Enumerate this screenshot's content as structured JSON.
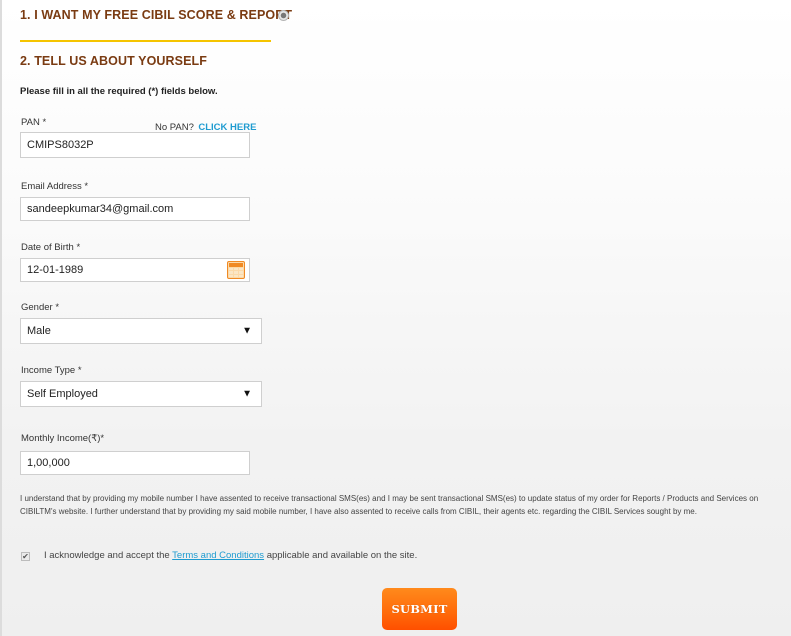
{
  "step1": {
    "title": "1. I WANT MY FREE CIBIL SCORE & REPORT"
  },
  "step2": {
    "title": "2. TELL US ABOUT YOURSELF"
  },
  "form": {
    "hint": "Please fill in all the required (*) fields below.",
    "pan": {
      "label": "PAN *",
      "no_pan_text": "No PAN?",
      "click_here": "CLICK HERE",
      "value": "CMIPS8032P"
    },
    "email": {
      "label": "Email Address *",
      "value": "sandeepkumar34@gmail.com"
    },
    "dob": {
      "label": "Date of Birth *",
      "value": "12-01-1989",
      "icon": "calendar-icon"
    },
    "gender": {
      "label": "Gender *",
      "selected": "Male",
      "arrow": "▼"
    },
    "income_type": {
      "label": "Income Type *",
      "selected": "Self Employed",
      "arrow": "▼"
    },
    "monthly_income": {
      "label": "Monthly Income(₹)*",
      "value": "1,00,000"
    },
    "disclaimer_line1": "I understand that by providing my mobile number I have assented to receive transactional SMS(es) and I may be sent transactional SMS(es) to update status of my order for Reports / Products and Services on",
    "disclaimer_line2": "CIBILTM's website. I further understand that by providing my said mobile number, I have also assented to receive calls from CIBIL, their agents etc. regarding the CIBIL Services sought by me.",
    "ack": {
      "checked": true,
      "check_mark": "✔",
      "before": "I acknowledge and accept the ",
      "link": "Terms and Conditions",
      "after": " applicable and available on the site."
    },
    "submit_label": "SUBMIT"
  },
  "colors": {
    "heading": "#7a3b12",
    "divider": "#f5c400",
    "link": "#1e9bd0",
    "submit": "#ff6a0a",
    "calendar": "#f08a24"
  }
}
